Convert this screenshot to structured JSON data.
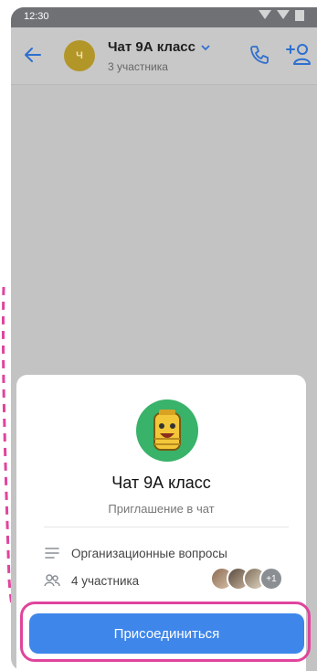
{
  "status_bar": {
    "time": "12:30"
  },
  "header": {
    "avatar_letter": "Ч",
    "title": "Чат 9А класс",
    "subtitle": "3 участника",
    "icons": [
      "back-arrow-icon",
      "chevron-down-icon",
      "phone-icon",
      "add-user-icon"
    ]
  },
  "sheet": {
    "title": "Чат 9А класс",
    "subtitle": "Приглашение в чат",
    "description": "Организационные вопросы",
    "members_label": "4 участника",
    "extra_members": "+1",
    "join_button": "Присоединиться"
  },
  "colors": {
    "accent": "#3e86ea",
    "highlight": "#e0449c",
    "avatar": "#b39628"
  }
}
